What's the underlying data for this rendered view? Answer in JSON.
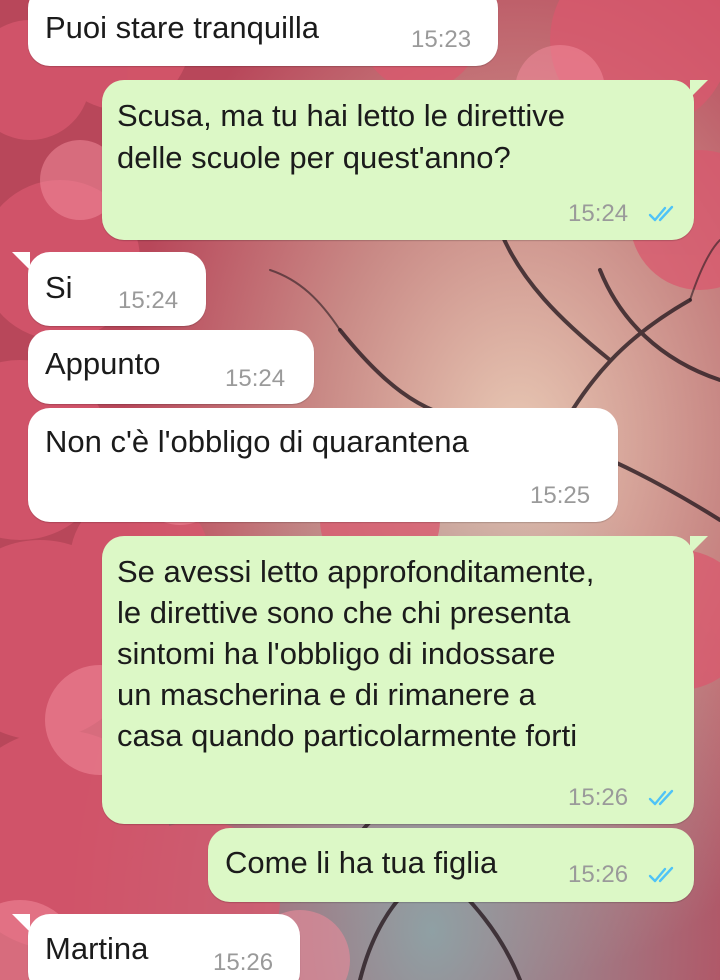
{
  "colors": {
    "incoming_bubble": "#ffffff",
    "outgoing_bubble": "#dcf8c6",
    "timestamp": "#9a9a9a",
    "read_receipt": "#4fc3f7",
    "text": "#1b1b1b"
  },
  "messages": [
    {
      "direction": "incoming",
      "lines": [
        "Puoi stare tranquilla"
      ],
      "time": "15:23"
    },
    {
      "direction": "outgoing",
      "lines": [
        "Scusa, ma tu hai letto le direttive",
        "delle scuole per quest'anno?"
      ],
      "time": "15:24",
      "status_icon": "double-check-read-icon"
    },
    {
      "direction": "incoming",
      "lines": [
        "Si"
      ],
      "time": "15:24"
    },
    {
      "direction": "incoming",
      "lines": [
        "Appunto"
      ],
      "time": "15:24"
    },
    {
      "direction": "incoming",
      "lines": [
        "Non c'è l'obbligo di quarantena"
      ],
      "time": "15:25"
    },
    {
      "direction": "outgoing",
      "lines": [
        "Se avessi letto approfonditamente,",
        "le direttive sono che chi presenta",
        "sintomi ha l'obbligo di indossare",
        "un mascherina e di rimanere a",
        "casa quando particolarmente forti"
      ],
      "time": "15:26",
      "status_icon": "double-check-read-icon"
    },
    {
      "direction": "outgoing",
      "lines": [
        "Come li ha tua figlia"
      ],
      "time": "15:26",
      "status_icon": "double-check-read-icon"
    },
    {
      "direction": "incoming",
      "lines": [
        "Martina"
      ],
      "time": "15:26"
    }
  ]
}
